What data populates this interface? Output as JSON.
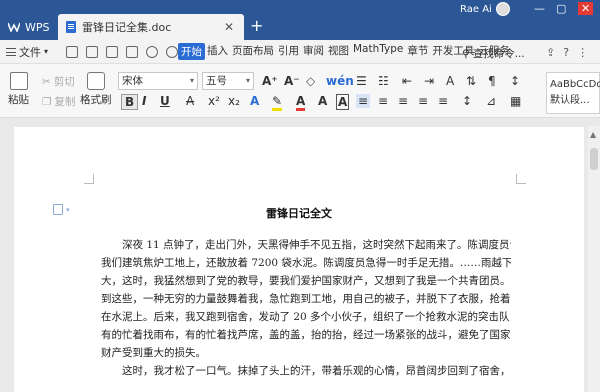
{
  "titlebar": {
    "app_tab": "WPS",
    "doc_tab": "雷锋日记全集.doc",
    "new_tab": "+",
    "user_name": "Rae Ai",
    "win_min": "—",
    "win_max": "▢",
    "win_close": "✕",
    "doc_close": "✕"
  },
  "menubar": {
    "file": "文件",
    "tabs": [
      "开始",
      "插入",
      "页面布局",
      "引用",
      "审阅",
      "视图",
      "MathType",
      "章节",
      "开发工具",
      "云服务"
    ],
    "active_tab": "开始",
    "search_cmd": "查找命令...",
    "help": "?",
    "more": "⋮"
  },
  "ribbon": {
    "paste": "粘贴",
    "cut": "剪切",
    "copy": "复制",
    "format_painter": "格式刷",
    "font_name": "宋体",
    "font_size": "五号",
    "style_preview": "AaBbCcDd",
    "style_name": "默认段..."
  },
  "document": {
    "title": "雷锋日记全文",
    "lines": [
      "深夜 11 点钟了，走出门外，天黑得伸手不见五指，这时突然下起雨来了。陈调度员说，",
      "我们建筑焦炉工地上，还散放着 7200 袋水泥。陈调度员急得一时手足无措。……雨越下越",
      "大，这时，我猛然想到了党的教导，要我们爱护国家财产，又想到了我是一个共青团员。想",
      "到这些，一种无穷的力量鼓舞着我，急忙跑到工地，用自己的被子，并脱下了衣服，抢着盖",
      "在水泥上。后来，我又跑到宿舍，发动了 20 多个小伙子，组织了一个抢救水泥的突击队，",
      "有的忙着找雨布，有的忙着找芦席，盖的盖，抬的抬，经过一场紧张的战斗，避免了国家的",
      "财产受到重大的损失。",
      "这时，我才松了一口气。抹掉了头上的汗，带着乐观的心情，昂首阔步回到了宿舍，回"
    ]
  }
}
